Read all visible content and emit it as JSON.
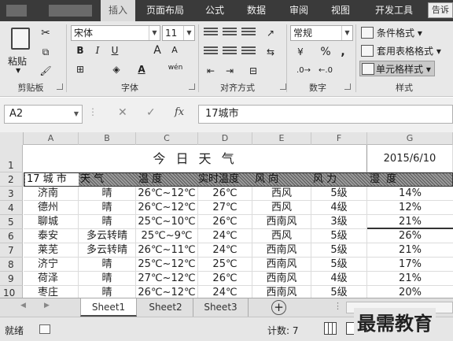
{
  "tabs": [
    "插入",
    "页面布局",
    "公式",
    "数据",
    "审阅",
    "视图",
    "开发工具"
  ],
  "help_text": "告诉",
  "clipboard": {
    "paste": "粘贴",
    "group": "剪贴板"
  },
  "font": {
    "name": "宋体",
    "size": "11",
    "bold": "B",
    "italic": "I",
    "underline": "U",
    "grow": "A",
    "shrink": "A",
    "color_a": "A",
    "wen": "wén",
    "group": "字体"
  },
  "alignment": {
    "group": "对齐方式"
  },
  "number": {
    "format": "常规",
    "percent": "%",
    "comma": ",",
    "group": "数字"
  },
  "styles": {
    "cond": "条件格式",
    "table": "套用表格格式",
    "cell": "单元格样式",
    "group": "样式"
  },
  "formula_bar": {
    "name_box": "A2",
    "fx": "fx",
    "value": "17城市"
  },
  "columns": [
    "A",
    "B",
    "C",
    "D",
    "E",
    "F",
    "G"
  ],
  "rows": [
    "1",
    "2",
    "3",
    "4",
    "5",
    "6",
    "7",
    "8",
    "9",
    "10"
  ],
  "sheet_title": "今 日 天 气",
  "sheet_date": "2015/6/10",
  "header_row": [
    "17 城 市",
    "天    气",
    "温    度",
    "实时温度",
    "风    向",
    "风    力",
    "湿    度"
  ],
  "table": [
    [
      "济南",
      "晴",
      "26℃~12℃",
      "26℃",
      "西风",
      "5级",
      "14%"
    ],
    [
      "德州",
      "晴",
      "26℃~12℃",
      "27℃",
      "西风",
      "4级",
      "12%"
    ],
    [
      "聊城",
      "晴",
      "25℃~10℃",
      "26℃",
      "西南风",
      "3级",
      "21%"
    ],
    [
      "泰安",
      "多云转晴",
      "25℃~9℃",
      "24℃",
      "西风",
      "5级",
      "26%"
    ],
    [
      "莱芜",
      "多云转晴",
      "26℃~11℃",
      "24℃",
      "西南风",
      "5级",
      "21%"
    ],
    [
      "济宁",
      "晴",
      "25℃~12℃",
      "25℃",
      "西南风",
      "5级",
      "17%"
    ],
    [
      "荷泽",
      "晴",
      "27℃~12℃",
      "26℃",
      "西南风",
      "4级",
      "21%"
    ],
    [
      "枣庄",
      "晴",
      "26℃~12℃",
      "24℃",
      "西南风",
      "5级",
      "20%"
    ]
  ],
  "sheets": [
    "Sheet1",
    "Sheet2",
    "Sheet3"
  ],
  "status": {
    "ready": "就绪",
    "count": "计数: 7"
  },
  "watermark": "最需教育",
  "colors": {
    "tabbar": "#3a3a3a",
    "ribbon": "#e8e8e8",
    "selection_fill": "#808080"
  }
}
